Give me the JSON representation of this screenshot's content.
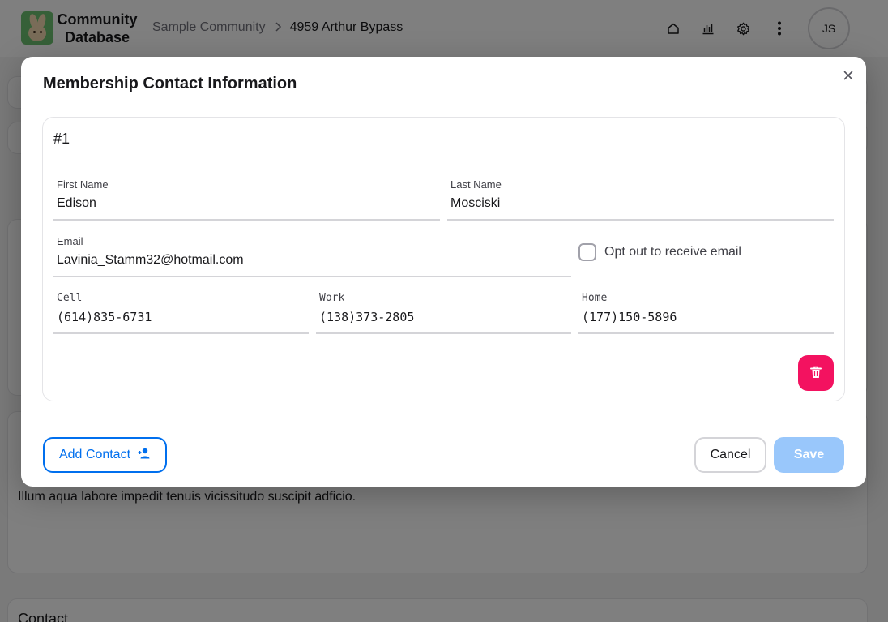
{
  "app": {
    "brand_line1": "Community",
    "brand_line2": "Database",
    "breadcrumb": [
      "Sample Community",
      "4959 Arthur Bypass"
    ],
    "avatar_initials": "JS",
    "nav_icons": [
      "home-icon",
      "chart-icon",
      "gear-icon",
      "more-vertical-icon"
    ]
  },
  "background": {
    "notes_text": "Illum aqua labore impedit tenuis vicissitudo suscipit adficio.",
    "contact_section_title": "Contact"
  },
  "modal": {
    "title": "Membership Contact Information",
    "contacts": [
      {
        "index_label": "#1",
        "first_name_label": "First Name",
        "first_name": "Edison",
        "last_name_label": "Last Name",
        "last_name": "Mosciski",
        "email_label": "Email",
        "email": "Lavinia_Stamm32@hotmail.com",
        "opt_out_label": "Opt out to receive email",
        "opt_out_checked": false,
        "cell_label": "Cell",
        "cell": "(614)835-6731",
        "work_label": "Work",
        "work": "(138)373-2805",
        "home_label": "Home",
        "home": "(177)150-5896"
      }
    ],
    "add_contact_label": "Add Contact",
    "cancel_label": "Cancel",
    "save_label": "Save"
  },
  "colors": {
    "primary": "#006fee",
    "primary_disabled": "#99c7fb",
    "danger": "#f31260"
  }
}
